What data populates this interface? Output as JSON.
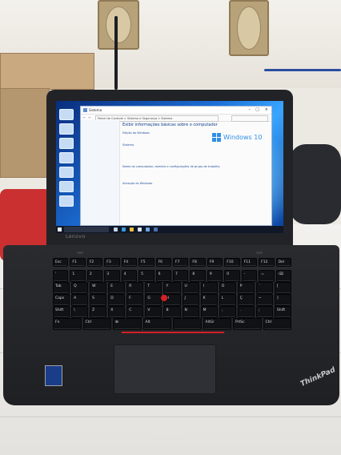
{
  "scene": {
    "description_hidden": "",
    "colors": {
      "accent_red": "#d61f26",
      "wallpaper_blue": "#1c6fd6",
      "laptop_body": "#222327"
    }
  },
  "screen_window": {
    "title": "Sistema",
    "address_path": "Painel de Controle > Sistema e Segurança > Sistema",
    "heading": "Exibir informações básicas sobre o computador",
    "section_edition": "Edição do Windows",
    "section_system": "Sistema",
    "section_computer": "Nome do computador, domínio e configurações de grupo de trabalho",
    "section_activation": "Ativação do Windows",
    "windows_logo_text": "Windows 10"
  },
  "taskbar": {
    "search_placeholder": "",
    "clock_time": "",
    "clock_date": ""
  },
  "branding": {
    "lid_logo": "Lenovo",
    "palmrest_logo": "ThinkPad"
  },
  "keyboard_rows": [
    [
      "Esc",
      "F1",
      "F2",
      "F3",
      "F4",
      "F5",
      "F6",
      "F7",
      "F8",
      "F9",
      "F10",
      "F11",
      "F12",
      "Del"
    ],
    [
      "'",
      "1",
      "2",
      "3",
      "4",
      "5",
      "6",
      "7",
      "8",
      "9",
      "0",
      "-",
      "=",
      "⌫"
    ],
    [
      "Tab",
      "Q",
      "W",
      "E",
      "R",
      "T",
      "Y",
      "U",
      "I",
      "O",
      "P",
      "´",
      "["
    ],
    [
      "Caps",
      "A",
      "S",
      "D",
      "F",
      "G",
      "H",
      "J",
      "K",
      "L",
      "Ç",
      "~",
      "]"
    ],
    [
      "Shift",
      "\\",
      "Z",
      "X",
      "C",
      "V",
      "B",
      "N",
      "M",
      ",",
      ".",
      ";",
      "Shift"
    ],
    [
      "Fn",
      "Ctrl",
      "⊞",
      "Alt",
      "",
      "AltGr",
      "PrtSc",
      "Ctrl"
    ]
  ]
}
